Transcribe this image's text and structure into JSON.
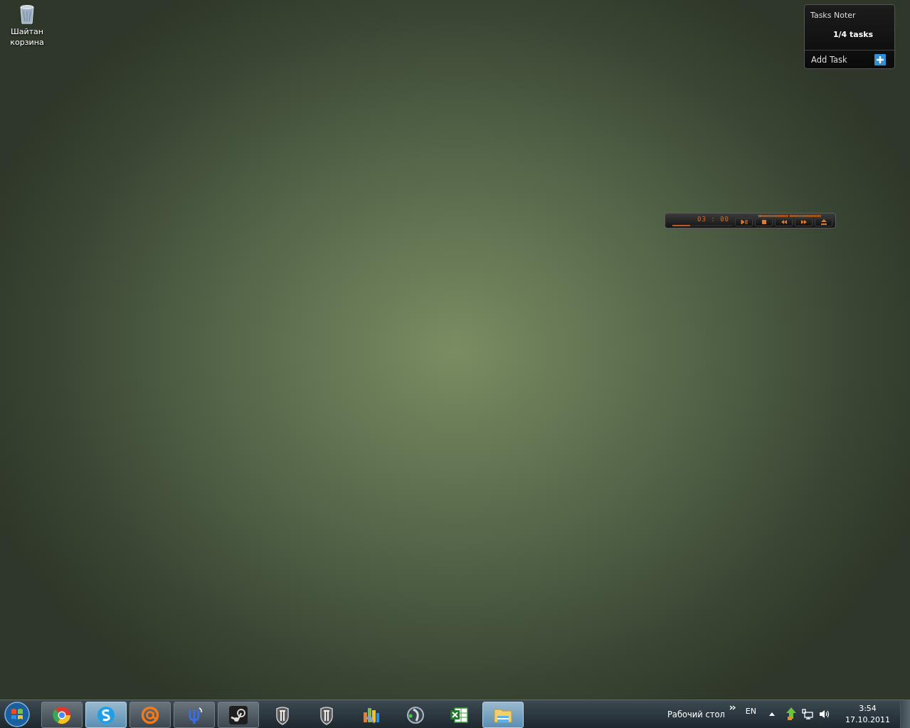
{
  "desktop_icons": [
    {
      "label": "Шайтан корзина"
    }
  ],
  "tasks_gadget": {
    "title": "Tasks Noter",
    "summary": "1/4 tasks",
    "add_label": "Add Task"
  },
  "media_gadget": {
    "time": "03 : 00",
    "level": 0.3
  },
  "taskbar": {
    "items": [
      {
        "kind": "browser",
        "running": true,
        "active": false
      },
      {
        "kind": "chat",
        "running": true,
        "active": true
      },
      {
        "kind": "mail",
        "running": true,
        "active": false
      },
      {
        "kind": "messenger",
        "running": true,
        "active": false
      },
      {
        "kind": "game-store",
        "running": true,
        "active": false
      },
      {
        "kind": "tank-game",
        "running": false,
        "active": false
      },
      {
        "kind": "tank-game",
        "running": false,
        "active": false
      },
      {
        "kind": "chart-app",
        "running": false,
        "active": false
      },
      {
        "kind": "voice-chat",
        "running": false,
        "active": false
      },
      {
        "kind": "spreadsheet",
        "running": false,
        "active": false
      },
      {
        "kind": "file-manager",
        "running": true,
        "active": true
      }
    ],
    "toolbar_label": "Рабочий стол",
    "language": "EN",
    "time": "3:54",
    "date": "17.10.2011"
  }
}
